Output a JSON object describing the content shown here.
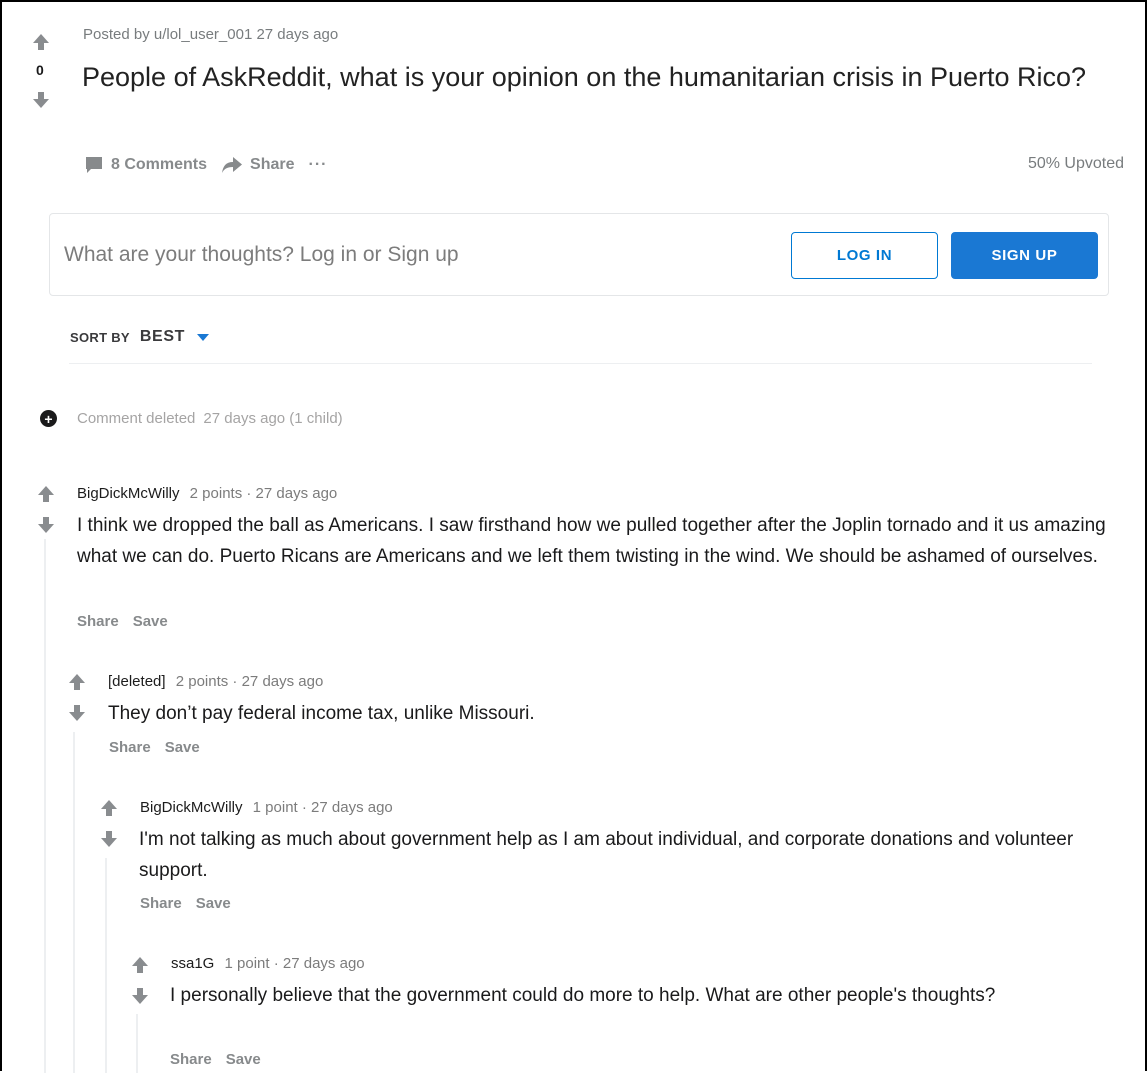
{
  "post": {
    "posted_by": "Posted by u/lol_user_001 27 days ago",
    "score": "0",
    "title": "People of AskReddit, what is your opinion on the humanitarian crisis in Puerto Rico?",
    "comments_label": "8 Comments",
    "share_label": "Share",
    "more_label": "···",
    "upvoted": "50% Upvoted"
  },
  "comment_box": {
    "prompt": "What are your thoughts? Log in or Sign up",
    "login": "LOG IN",
    "signup": "SIGN UP"
  },
  "sort": {
    "label": "SORT BY",
    "value": "BEST"
  },
  "deleted_comment": {
    "label": "Comment deleted",
    "meta": "27 days ago (1 child)"
  },
  "comments": [
    {
      "user": "BigDickMcWilly",
      "meta": "2 points · 27 days ago",
      "body": "I think we dropped the ball as Americans. I saw firsthand how we pulled together after the Joplin tornado and it us amazing what we can do. Puerto Ricans are Americans and we left them twisting in the wind. We should be ashamed of ourselves.",
      "share": "Share",
      "save": "Save"
    },
    {
      "user": "[deleted]",
      "meta": "2 points · 27 days ago",
      "body": "They don’t pay federal income tax, unlike Missouri.",
      "share": "Share",
      "save": "Save"
    },
    {
      "user": "BigDickMcWilly",
      "meta": "1 point · 27 days ago",
      "body": "I'm not talking as much about government help as I am about individual, and corporate donations and volunteer support.",
      "share": "Share",
      "save": "Save"
    },
    {
      "user": "ssa1G",
      "meta": "1 point · 27 days ago",
      "body": "I personally believe that the government could do more to help. What are other people's thoughts?",
      "share": "Share",
      "save": "Save"
    }
  ],
  "colors": {
    "accent": "#1a78d3",
    "muted_text": "#787c7e",
    "arrow": "#898c8f"
  }
}
